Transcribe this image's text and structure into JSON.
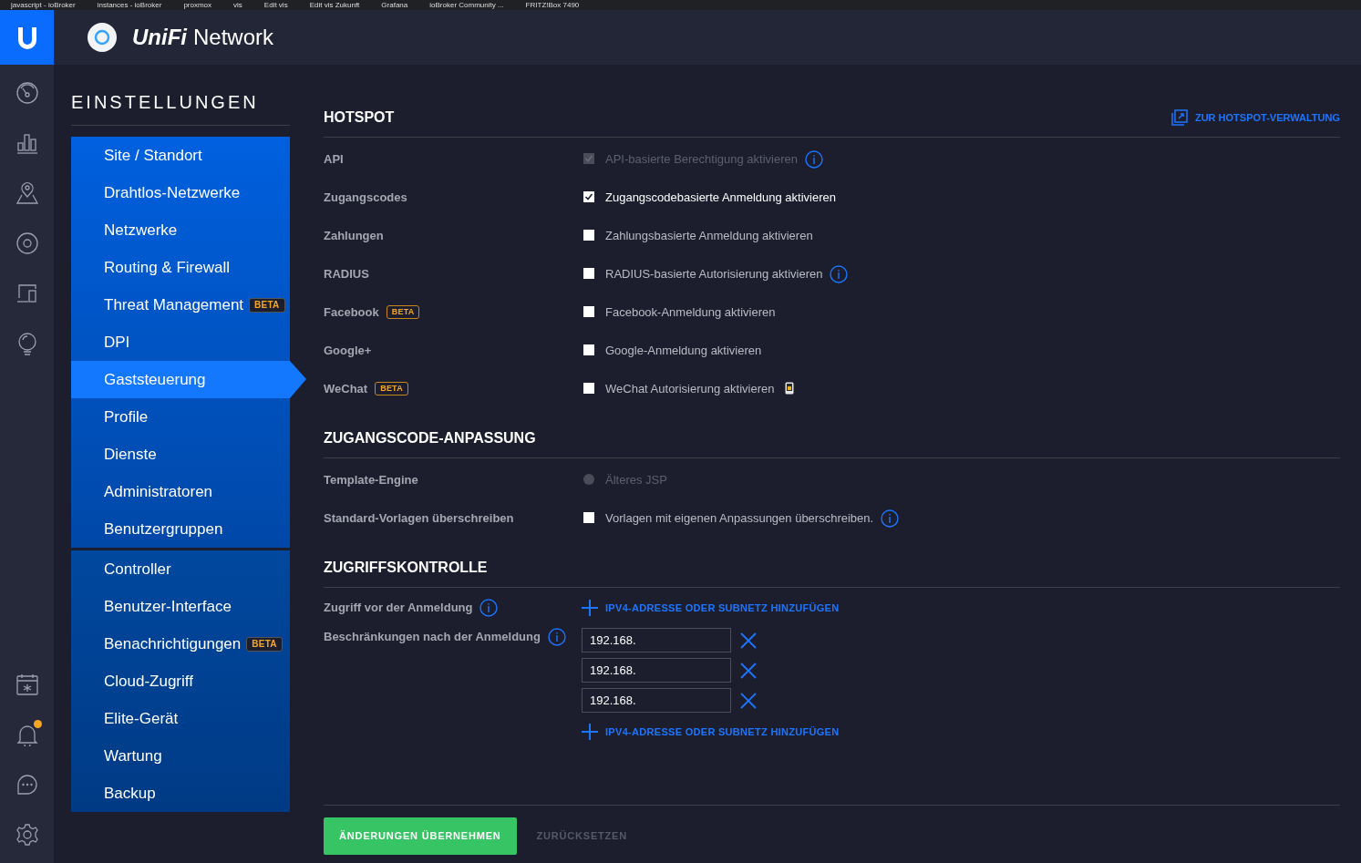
{
  "bookmarks": [
    "javascript - ioBroker",
    "instances - ioBroker",
    "proxmox",
    "vis",
    "Edit vis",
    "Edit vis Zukunft",
    "Grafana",
    "ioBroker Community ...",
    "FRITZ!Box 7490"
  ],
  "header": {
    "brand": "UniFi",
    "product": "Network"
  },
  "rail": [
    {
      "kind": "dashboard"
    },
    {
      "kind": "stats"
    },
    {
      "kind": "map"
    },
    {
      "kind": "devices"
    },
    {
      "kind": "clients"
    },
    {
      "kind": "insights"
    }
  ],
  "rail_bottom": [
    {
      "kind": "events",
      "dot": false
    },
    {
      "kind": "alerts",
      "dot": true
    },
    {
      "kind": "chat",
      "dot": false
    },
    {
      "kind": "settings",
      "dot": false
    }
  ],
  "settings": {
    "title": "EINSTELLUNGEN",
    "groups": [
      [
        {
          "label": "Site / Standort",
          "selected": false
        },
        {
          "label": "Drahtlos-Netzwerke",
          "selected": false
        },
        {
          "label": "Netzwerke",
          "selected": false
        },
        {
          "label": "Routing & Firewall",
          "selected": false
        },
        {
          "label": "Threat Management",
          "badge": "BETA",
          "selected": false
        },
        {
          "label": "DPI",
          "selected": false
        },
        {
          "label": "Gaststeuerung",
          "selected": true
        },
        {
          "label": "Profile",
          "selected": false
        },
        {
          "label": "Dienste",
          "selected": false
        },
        {
          "label": "Administratoren",
          "selected": false
        },
        {
          "label": "Benutzergruppen",
          "selected": false
        }
      ],
      [
        {
          "label": "Controller",
          "selected": false
        },
        {
          "label": "Benutzer-Interface",
          "selected": false
        },
        {
          "label": "Benachrichtigungen",
          "badge": "BETA",
          "selected": false
        },
        {
          "label": "Cloud-Zugriff",
          "selected": false
        },
        {
          "label": "Elite-Gerät",
          "selected": false
        },
        {
          "label": "Wartung",
          "selected": false
        },
        {
          "label": "Backup",
          "selected": false
        }
      ]
    ]
  },
  "hotspot": {
    "title": "HOTSPOT",
    "link": "ZUR HOTSPOT-VERWALTUNG",
    "rows": [
      {
        "label": "API",
        "kind": "checkbox",
        "text": "API-basierte Berechtigung aktivieren",
        "checked": true,
        "disabled": true,
        "info": true
      },
      {
        "label": "Zugangscodes",
        "kind": "checkbox",
        "text": "Zugangscodebasierte Anmeldung aktivieren",
        "checked": true,
        "disabled": false
      },
      {
        "label": "Zahlungen",
        "kind": "checkbox",
        "text": "Zahlungsbasierte Anmeldung aktivieren",
        "checked": false,
        "disabled": false
      },
      {
        "label": "RADIUS",
        "kind": "checkbox",
        "text": "RADIUS-basierte Autorisierung aktivieren",
        "checked": false,
        "disabled": false,
        "info": true
      },
      {
        "label": "Facebook",
        "badge": "BETA",
        "kind": "checkbox",
        "text": "Facebook-Anmeldung aktivieren",
        "checked": false,
        "disabled": false
      },
      {
        "label": "Google+",
        "kind": "checkbox",
        "text": "Google-Anmeldung aktivieren",
        "checked": false,
        "disabled": false
      },
      {
        "label": "WeChat",
        "badge": "BETA",
        "kind": "checkbox",
        "text": "WeChat Autorisierung aktivieren",
        "checked": false,
        "disabled": false,
        "phone": true
      }
    ]
  },
  "customization": {
    "title": "ZUGANGSCODE-ANPASSUNG",
    "rows": [
      {
        "label": "Template-Engine",
        "kind": "radio",
        "text": "Älteres JSP",
        "checked": false,
        "disabled": true
      },
      {
        "label": "Standard-Vorlagen überschreiben",
        "kind": "checkbox",
        "text": "Vorlagen mit eigenen Anpassungen überschreiben.",
        "checked": false,
        "disabled": false,
        "info": true
      }
    ]
  },
  "access": {
    "title": "ZUGRIFFSKONTROLLE",
    "pre_login": {
      "label": "Zugriff vor der Anmeldung",
      "add": "IPV4-ADRESSE ODER SUBNETZ HINZUFÜGEN"
    },
    "post_login": {
      "label": "Beschränkungen nach der Anmeldung",
      "entries": [
        "192.168.",
        "192.168.",
        "192.168."
      ],
      "add": "IPV4-ADRESSE ODER SUBNETZ HINZUFÜGEN"
    }
  },
  "footer": {
    "apply": "ÄNDERUNGEN ÜBERNEHMEN",
    "reset": "ZURÜCKSETZEN"
  }
}
